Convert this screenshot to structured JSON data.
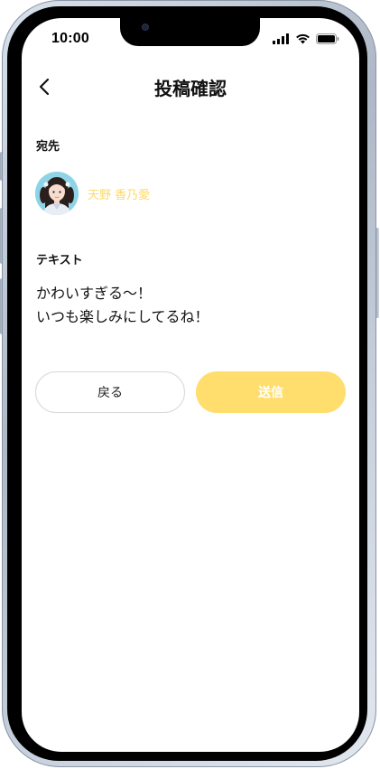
{
  "status_bar": {
    "time": "10:00",
    "icons": [
      "cellular-signal-icon",
      "wifi-icon",
      "battery-icon"
    ]
  },
  "header": {
    "back_icon": "chevron-left-icon",
    "title": "投稿確認"
  },
  "recipient_section": {
    "label": "宛先",
    "recipient": {
      "name": "天野 香乃愛",
      "avatar": "avatar"
    }
  },
  "text_section": {
    "label": "テキスト",
    "lines": [
      "かわいすぎる〜！",
      "いつも楽しみにしてるね！"
    ]
  },
  "actions": {
    "back_label": "戻る",
    "send_label": "送信"
  },
  "colors": {
    "accent": "#ffde6e",
    "recipient_name": "#ffd966",
    "avatar_bg": "#8fd3e6"
  }
}
